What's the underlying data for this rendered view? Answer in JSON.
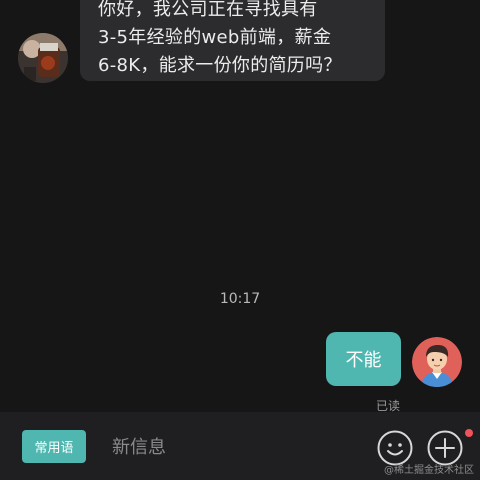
{
  "incoming_message": {
    "lines": [
      "你好，我公司正在寻找具有",
      "3-5年经验的web前端，薪金",
      "6-8K，能求一份你的简历吗？"
    ]
  },
  "timestamp": "10:17",
  "outgoing_message": {
    "text": "不能",
    "status": "已读"
  },
  "input_bar": {
    "phrases_label": "常用语",
    "placeholder": "新信息",
    "emoji_icon": "smiley-icon",
    "plus_icon": "plus-icon"
  },
  "watermark": "@稀土掘金技术社区",
  "colors": {
    "accent": "#4fb7b0",
    "background": "#161617",
    "bubble_incoming": "#2c2c2e",
    "input_bar": "#1f1f21",
    "badge": "#f0545a"
  }
}
